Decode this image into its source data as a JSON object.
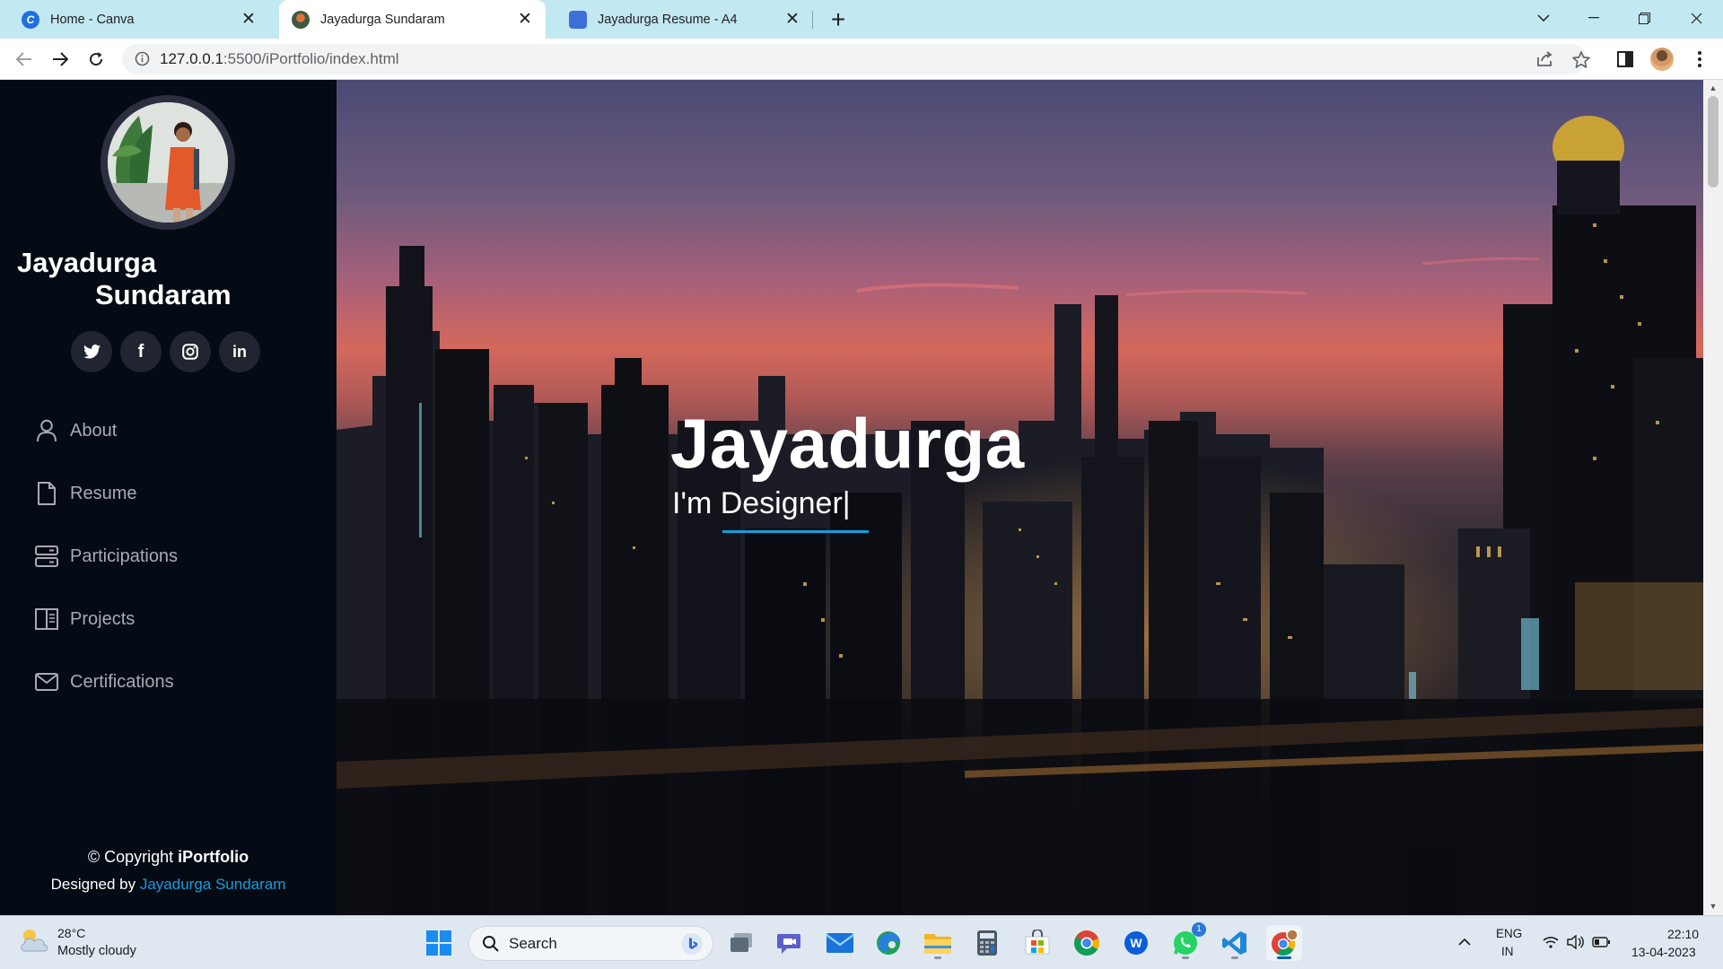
{
  "browser": {
    "tabs": [
      {
        "label": "Home - Canva",
        "active": false,
        "favicon": "canva-icon"
      },
      {
        "label": "Jayadurga Sundaram",
        "active": true,
        "favicon": "profile-photo-icon"
      },
      {
        "label": "Jayadurga Resume - A4",
        "active": false,
        "favicon": "printer-icon"
      }
    ],
    "url": {
      "host": "127.0.0.1",
      "path": ":5500/iPortfolio/index.html"
    }
  },
  "sidebar": {
    "name_first": "Jayadurga",
    "name_last": "Sundaram",
    "social": [
      {
        "icon": "twitter-icon"
      },
      {
        "icon": "facebook-icon",
        "glyph": "f"
      },
      {
        "icon": "instagram-icon"
      },
      {
        "icon": "linkedin-icon",
        "glyph": "in"
      }
    ],
    "nav": [
      {
        "label": "About",
        "icon": "person-icon"
      },
      {
        "label": "Resume",
        "icon": "file-icon"
      },
      {
        "label": "Participations",
        "icon": "server-icon"
      },
      {
        "label": "Projects",
        "icon": "book-half-icon"
      },
      {
        "label": "Certifications",
        "icon": "envelope-icon"
      }
    ],
    "footer": {
      "copyright_prefix": "© Copyright ",
      "copyright_brand": "iPortfolio",
      "designed_prefix": "Designed by ",
      "designed_author": "Jayadurga Sundaram"
    }
  },
  "hero": {
    "title": "Jayadurga",
    "subtitle": "I'm Designer|"
  },
  "taskbar": {
    "weather": {
      "temp": "28°C",
      "desc": "Mostly cloudy"
    },
    "search_label": "Search",
    "whatsapp_badge": "1",
    "tray": {
      "lang_line1": "ENG",
      "lang_line2": "IN",
      "time": "22:10",
      "date": "13-04-2023"
    }
  },
  "colors": {
    "sidebar_bg": "#040b14",
    "accent": "#149ddd",
    "tab_strip": "#c2e8f2",
    "taskbar_bg": "#dfe8f1"
  }
}
